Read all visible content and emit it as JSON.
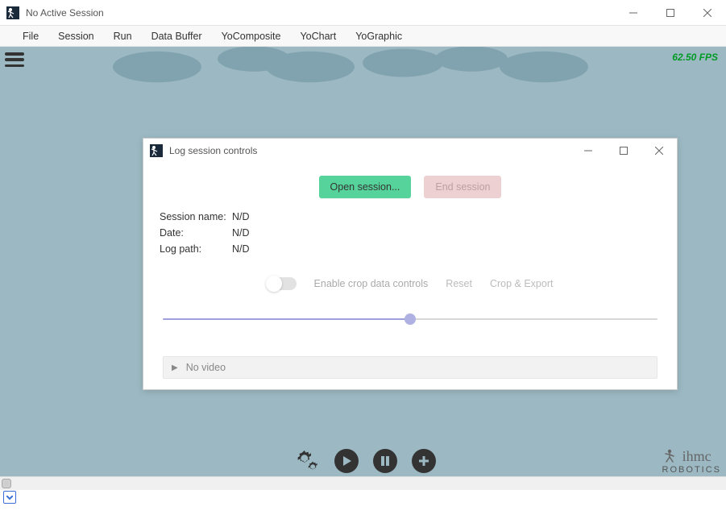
{
  "main_window": {
    "title": "No Active Session"
  },
  "menu": [
    "File",
    "Session",
    "Run",
    "Data Buffer",
    "YoComposite",
    "YoChart",
    "YoGraphic"
  ],
  "fps": "62.50 FPS",
  "dialog": {
    "title": "Log session controls",
    "open_btn": "Open session...",
    "end_btn": "End session",
    "session_name_label": "Session name:",
    "session_name_value": "N/D",
    "date_label": "Date:",
    "date_value": "N/D",
    "log_path_label": "Log path:",
    "log_path_value": "N/D",
    "enable_crop": "Enable crop data controls",
    "reset": "Reset",
    "crop_export": "Crop & Export",
    "no_video": "No video"
  },
  "logo": {
    "top": "ihmc",
    "bottom": "ROBOTICS"
  }
}
